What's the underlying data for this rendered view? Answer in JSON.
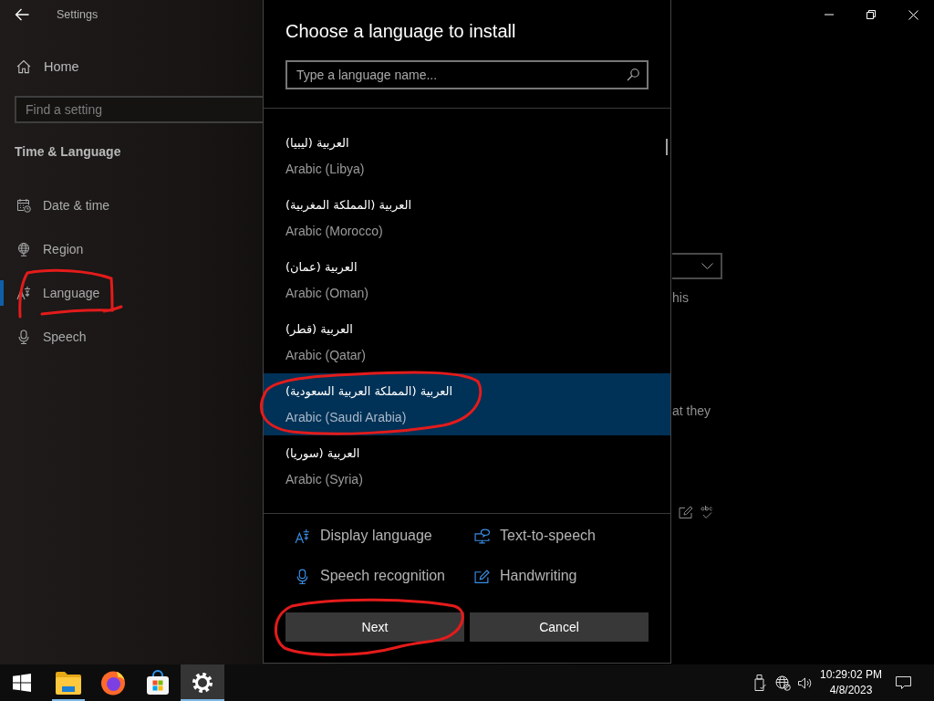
{
  "settings_window": {
    "title": "Settings",
    "home": "Home",
    "search": {
      "placeholder": "Find a setting"
    },
    "section_title": "Time & Language",
    "nav": [
      {
        "label": "Date & time",
        "selected": false,
        "circled": false
      },
      {
        "label": "Region",
        "selected": false,
        "circled": false
      },
      {
        "label": "Language",
        "selected": true,
        "circled": true
      },
      {
        "label": "Speech",
        "selected": false,
        "circled": false
      }
    ],
    "content_fragments": [
      "his",
      "at they"
    ]
  },
  "dialog": {
    "title": "Choose a language to install",
    "search": {
      "placeholder": "Type a language name..."
    },
    "languages": [
      {
        "native": "العربية (ليبيا)",
        "english": "Arabic (Libya)",
        "selected": false,
        "circled": false
      },
      {
        "native": "العربية (المملكة المغربية)",
        "english": "Arabic (Morocco)",
        "selected": false,
        "circled": false
      },
      {
        "native": "العربية (عمان)",
        "english": "Arabic (Oman)",
        "selected": false,
        "circled": false
      },
      {
        "native": "العربية (قطر)",
        "english": "Arabic (Qatar)",
        "selected": false,
        "circled": false
      },
      {
        "native": "العربية (المملكة العربية السعودية)",
        "english": "Arabic (Saudi Arabia)",
        "selected": true,
        "circled": true
      },
      {
        "native": "العربية (سوريا)",
        "english": "Arabic (Syria)",
        "selected": false,
        "circled": false
      }
    ],
    "features": [
      "Display language",
      "Text-to-speech",
      "Speech recognition",
      "Handwriting"
    ],
    "buttons": [
      {
        "label": "Next",
        "circled": true
      },
      {
        "label": "Cancel",
        "circled": false
      }
    ]
  },
  "taskbar": {
    "apps": [
      {
        "kind": "start",
        "running": false,
        "active": false
      },
      {
        "kind": "folder",
        "running": true,
        "active": false
      },
      {
        "kind": "browser",
        "running": false,
        "active": false
      },
      {
        "kind": "store",
        "running": false,
        "active": false
      },
      {
        "kind": "settings",
        "running": true,
        "active": true
      }
    ],
    "clock": {
      "time": "10:29:02 PM",
      "date": "4/8/2023"
    }
  }
}
